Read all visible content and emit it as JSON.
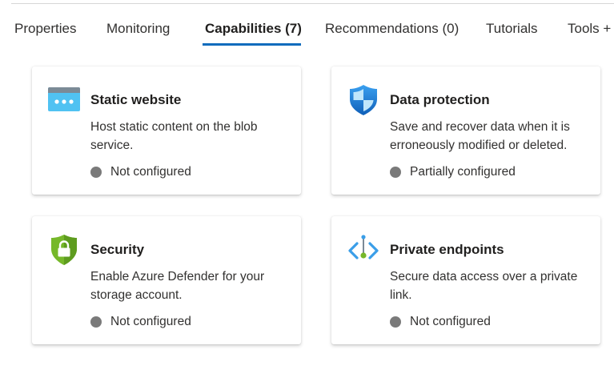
{
  "tabs": [
    {
      "label": "Properties"
    },
    {
      "label": "Monitoring"
    },
    {
      "label": "Capabilities (7)"
    },
    {
      "label": "Recommendations (0)"
    },
    {
      "label": "Tutorials"
    },
    {
      "label": "Tools +"
    }
  ],
  "active_tab": "Capabilities (7)",
  "colors": {
    "accent": "#0f6cbd",
    "status_dot": "#7a7a7a"
  },
  "cards": [
    {
      "icon": "static-website-icon",
      "title": "Static website",
      "description": "Host static content on the blob service.",
      "status": "Not configured"
    },
    {
      "icon": "shield-icon",
      "title": "Data protection",
      "description": "Save and recover data when it is erroneously modified or deleted.",
      "status": "Partially configured"
    },
    {
      "icon": "lock-shield-icon",
      "title": "Security",
      "description": "Enable Azure Defender for your storage account.",
      "status": "Not configured"
    },
    {
      "icon": "private-endpoint-icon",
      "title": "Private endpoints",
      "description": "Secure data access over a private link.",
      "status": "Not configured"
    }
  ]
}
